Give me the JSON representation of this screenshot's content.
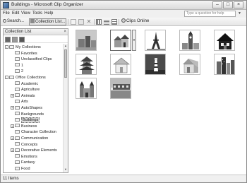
{
  "window": {
    "title": "Buildings - Microsoft Clip Organizer",
    "controls": [
      "minimize",
      "maximize",
      "close"
    ]
  },
  "menu": {
    "items": [
      "File",
      "Edit",
      "View",
      "Tools",
      "Help"
    ],
    "help_placeholder": "Type a question for help"
  },
  "toolbar": {
    "search_label": "Search...",
    "collection_list_label": "Collection List...",
    "clips_online_label": "Clips Online",
    "icons": [
      "copy-icon",
      "paste-icon",
      "delete-icon",
      "thumbnail-view-icon",
      "list-view-icon",
      "details-view-icon",
      "clips-online-icon"
    ]
  },
  "left_pane": {
    "title": "Collection List",
    "tree": [
      {
        "label": "My Collections",
        "level": 0,
        "expander": "-"
      },
      {
        "label": "Favorites",
        "level": 1
      },
      {
        "label": "Unclassified Clips",
        "level": 1
      },
      {
        "label": "1",
        "level": 1
      },
      {
        "label": "2",
        "level": 1
      },
      {
        "label": "Office Collections",
        "level": 0,
        "expander": "-"
      },
      {
        "label": "Academic",
        "level": 1
      },
      {
        "label": "Agriculture",
        "level": 1
      },
      {
        "label": "Animals",
        "level": 1,
        "expander": "+"
      },
      {
        "label": "Arts",
        "level": 1
      },
      {
        "label": "AutoShapes",
        "level": 1,
        "expander": "+"
      },
      {
        "label": "Backgrounds",
        "level": 1
      },
      {
        "label": "Buildings",
        "level": 1,
        "selected": true
      },
      {
        "label": "Business",
        "level": 1,
        "expander": "+"
      },
      {
        "label": "Character Collection",
        "level": 1
      },
      {
        "label": "Communication",
        "level": 1,
        "expander": "+"
      },
      {
        "label": "Concepts",
        "level": 1
      },
      {
        "label": "Decorative Elements",
        "level": 1,
        "expander": "+"
      },
      {
        "label": "Emotions",
        "level": 1
      },
      {
        "label": "Fantasy",
        "level": 1
      },
      {
        "label": "Food",
        "level": 1
      }
    ]
  },
  "clips": {
    "items": [
      {
        "name": "clip-buildings-photo",
        "kind": "photo-grey"
      },
      {
        "name": "clip-row-houses",
        "kind": "houses",
        "selected": true
      },
      {
        "name": "clip-eiffel-tower",
        "kind": "eiffel"
      },
      {
        "name": "clip-big-ben",
        "kind": "bigben"
      },
      {
        "name": "clip-house-icon",
        "kind": "house-dark"
      },
      {
        "name": "clip-pagoda",
        "kind": "pagoda"
      },
      {
        "name": "clip-house-drawing",
        "kind": "house-light"
      },
      {
        "name": "clip-lighthouse",
        "kind": "lighthouse"
      },
      {
        "name": "clip-house-3d",
        "kind": "house-3d"
      },
      {
        "name": "clip-city-skyline",
        "kind": "skyline"
      },
      {
        "name": "clip-castle",
        "kind": "castle"
      },
      {
        "name": "clip-waterfront-photo",
        "kind": "photo-water"
      }
    ]
  },
  "status": {
    "text": "11 Items"
  }
}
